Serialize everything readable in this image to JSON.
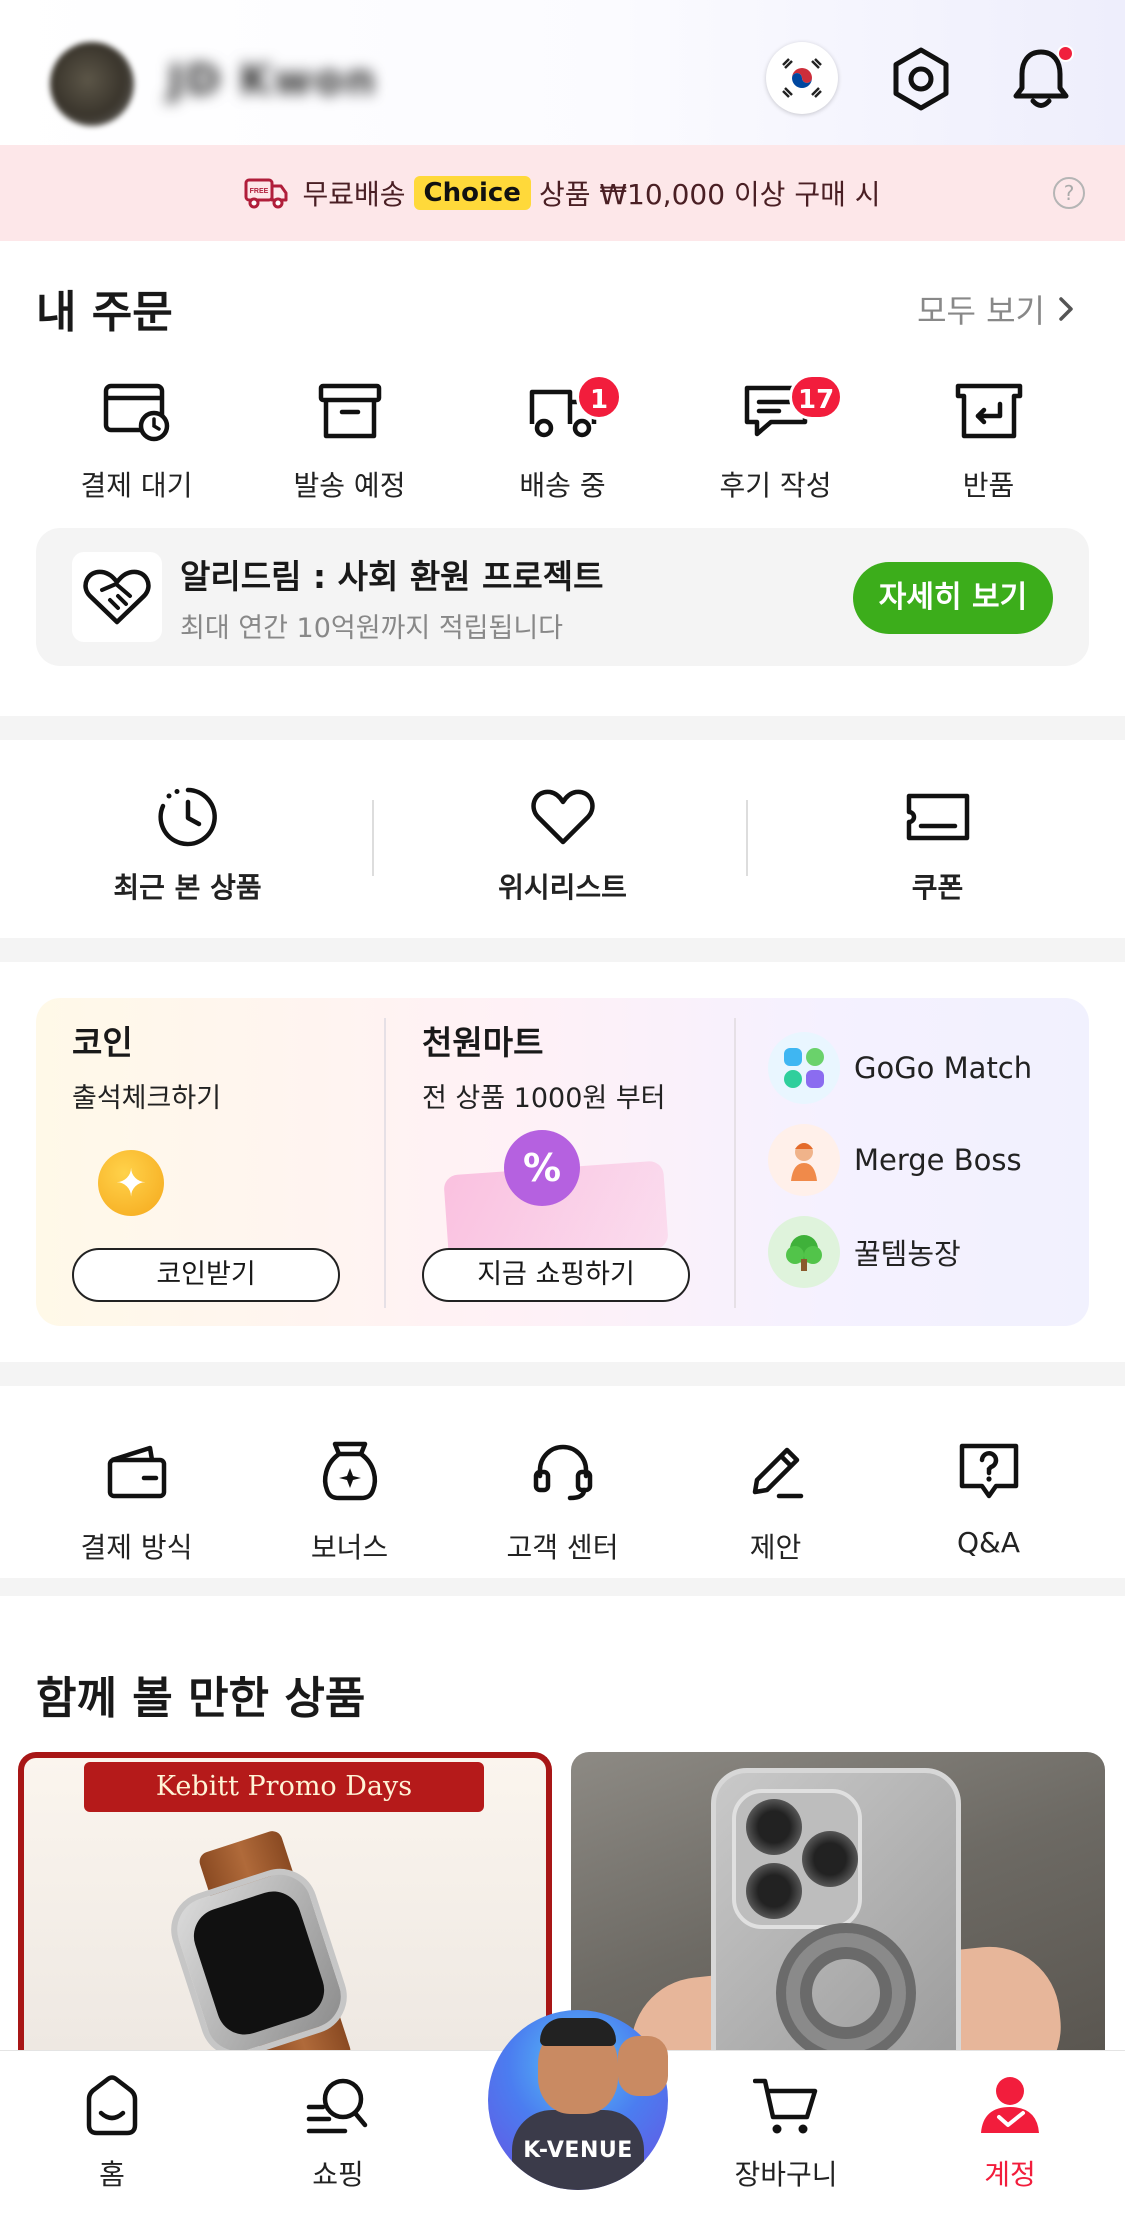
{
  "header": {
    "username": "JD Kwon",
    "flag_icon": "korea-flag-icon",
    "settings_icon": "settings-icon",
    "bell_icon": "bell-icon"
  },
  "banner": {
    "prefix": "무료배송",
    "choice": "Choice",
    "suffix": "상품 ₩10,000 이상 구매 시",
    "truck_icon": "free-shipping-truck-icon",
    "help_icon": "help-icon",
    "help_glyph": "?"
  },
  "orders": {
    "title": "내 주문",
    "view_all": "모두 보기",
    "items": [
      {
        "label": "결제 대기",
        "icon": "pending-payment-icon",
        "badge": ""
      },
      {
        "label": "발송 예정",
        "icon": "box-icon",
        "badge": ""
      },
      {
        "label": "배송 중",
        "icon": "truck-icon",
        "badge": "1"
      },
      {
        "label": "후기 작성",
        "icon": "review-icon",
        "badge": "17"
      },
      {
        "label": "반품",
        "icon": "return-icon",
        "badge": ""
      }
    ]
  },
  "dream": {
    "title": "알리드림 : 사회 환원 프로젝트",
    "subtitle": "최대 연간 10억원까지 적립됩니다",
    "button": "자세히 보기",
    "icon": "heart-handshake-icon"
  },
  "shortcuts": [
    {
      "label": "최근 본 상품",
      "icon": "clock-icon"
    },
    {
      "label": "위시리스트",
      "icon": "heart-icon"
    },
    {
      "label": "쿠폰",
      "icon": "coupon-icon"
    }
  ],
  "activities": {
    "coin": {
      "title": "코인",
      "subtitle": "출석체크하기",
      "button": "코인받기",
      "icon": "coin-icon"
    },
    "mart": {
      "title": "천원마트",
      "subtitle": "전 상품 1000원 부터",
      "button": "지금 쇼핑하기",
      "icon": "percent-badge-icon",
      "percent": "%"
    },
    "games": [
      {
        "label": "GoGo Match",
        "icon": "gogo-match-icon"
      },
      {
        "label": "Merge Boss",
        "icon": "merge-boss-icon"
      },
      {
        "label": "꿀템농장",
        "icon": "farm-icon"
      }
    ]
  },
  "menu": [
    {
      "label": "결제 방식",
      "icon": "wallet-icon"
    },
    {
      "label": "보너스",
      "icon": "bonus-bag-icon"
    },
    {
      "label": "고객 센터",
      "icon": "headset-icon"
    },
    {
      "label": "제안",
      "icon": "pencil-icon"
    },
    {
      "label": "Q&A",
      "icon": "question-chat-icon"
    }
  ],
  "recommendations": {
    "title": "함께 볼 만한 상품",
    "products": [
      {
        "banner": "Kebitt Promo Days",
        "image": "apple-watch-leather-band"
      },
      {
        "banner": "",
        "image": "clear-iphone-case"
      }
    ]
  },
  "bottom_nav": {
    "items": [
      {
        "label": "홈",
        "icon": "home-icon"
      },
      {
        "label": "쇼핑",
        "icon": "search-shopping-icon"
      },
      {
        "label": "장바구니",
        "icon": "cart-icon"
      },
      {
        "label": "계정",
        "icon": "account-icon"
      }
    ],
    "center": {
      "label": "K-VENUE"
    }
  },
  "colors": {
    "accent_red": "#f21d3c",
    "choice_yellow": "#ffd93a",
    "green": "#3cad1b",
    "banner_pink": "#fde7e9"
  }
}
